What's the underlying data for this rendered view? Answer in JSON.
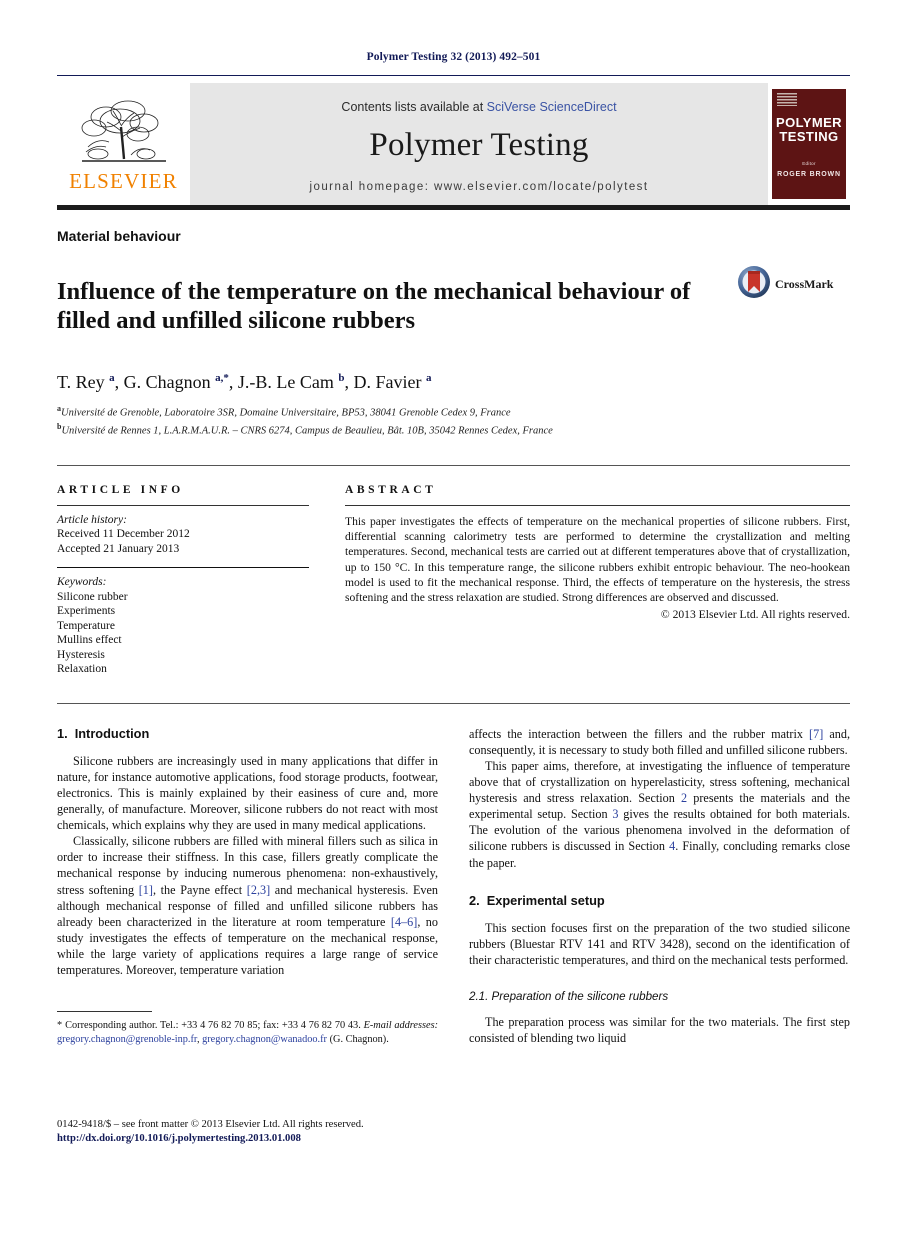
{
  "running_head": "Polymer Testing 32 (2013) 492–501",
  "masthead": {
    "publisher_word": "ELSEVIER",
    "contents_prefix": "Contents lists available at ",
    "contents_link": "SciVerse ScienceDirect",
    "journal_name": "Polymer Testing",
    "homepage": "journal homepage: www.elsevier.com/locate/polytest",
    "cover": {
      "title_line1": "POLYMER",
      "title_line2": "TESTING",
      "editor_label": "Editor",
      "editor_name": "ROGER BROWN"
    }
  },
  "article": {
    "section_label": "Material behaviour",
    "title": "Influence of the temperature on the mechanical behaviour of filled and unfilled silicone rubbers",
    "crossmark_label": "CrossMark",
    "affiliation_a": "Université de Grenoble, Laboratoire 3SR, Domaine Universitaire, BP53, 38041 Grenoble Cedex 9, France",
    "affiliation_b": "Université de Rennes 1, L.A.R.M.A.U.R. – CNRS 6274, Campus de Beaulieu, Bât. 10B, 35042 Rennes Cedex, France"
  },
  "article_info": {
    "heading": "ARTICLE INFO",
    "history_label": "Article history:",
    "received": "Received 11 December 2012",
    "accepted": "Accepted 21 January 2013",
    "keywords_label": "Keywords:",
    "keywords": [
      "Silicone rubber",
      "Experiments",
      "Temperature",
      "Mullins effect",
      "Hysteresis",
      "Relaxation"
    ]
  },
  "abstract": {
    "heading": "ABSTRACT",
    "text": "This paper investigates the effects of temperature on the mechanical properties of silicone rubbers. First, differential scanning calorimetry tests are performed to determine the crystallization and melting temperatures. Second, mechanical tests are carried out at different temperatures above that of crystallization, up to 150 °C. In this temperature range, the silicone rubbers exhibit entropic behaviour. The neo-hookean model is used to fit the mechanical response. Third, the effects of temperature on the hysteresis, the stress softening and the stress relaxation are studied. Strong differences are observed and discussed.",
    "copyright": "© 2013 Elsevier Ltd. All rights reserved."
  },
  "body": {
    "intro_heading_num": "1.",
    "intro_heading": "Introduction",
    "intro_p1": "Silicone rubbers are increasingly used in many applications that differ in nature, for instance automotive applications, food storage products, footwear, electronics. This is mainly explained by their easiness of cure and, more generally, of manufacture. Moreover, silicone rubbers do not react with most chemicals, which explains why they are used in many medical applications.",
    "intro_p2_a": "Classically, silicone rubbers are filled with mineral fillers such as silica in order to increase their stiffness. In this case, fillers greatly complicate the mechanical response by inducing numerous phenomena: non-exhaustively, stress softening ",
    "intro_p2_ref1": "[1]",
    "intro_p2_b": ", the Payne effect ",
    "intro_p2_ref2": "[2,3]",
    "intro_p2_c": " and mechanical hysteresis. Even although mechanical response of filled and unfilled silicone rubbers has already been characterized in the literature at room temperature ",
    "intro_p2_ref3": "[4–6]",
    "intro_p2_d": ", no study investigates the effects of temperature on the mechanical response, while the large variety of applications requires a large range of service temperatures. Moreover, temperature variation",
    "right_p1_a": "affects the interaction between the fillers and the rubber matrix ",
    "right_p1_ref": "[7]",
    "right_p1_b": " and, consequently, it is necessary to study both filled and unfilled silicone rubbers.",
    "right_p2_a": "This paper aims, therefore, at investigating the influence of temperature above that of crystallization on hyperelasticity, stress softening, mechanical hysteresis and stress relaxation. Section ",
    "right_p2_s2": "2",
    "right_p2_b": " presents the materials and the experimental setup. Section ",
    "right_p2_s3": "3",
    "right_p2_c": " gives the results obtained for both materials. The evolution of the various phenomena involved in the deformation of silicone rubbers is discussed in Section ",
    "right_p2_s4": "4",
    "right_p2_d": ". Finally, concluding remarks close the paper.",
    "exp_heading_num": "2.",
    "exp_heading": "Experimental setup",
    "exp_p1": "This section focuses first on the preparation of the two studied silicone rubbers (Bluestar RTV 141 and RTV 3428), second on the identification of their characteristic temperatures, and third on the mechanical tests performed.",
    "subsec_heading": "2.1. Preparation of the silicone rubbers",
    "exp_p2": "The preparation process was similar for the two materials. The first step consisted of blending two liquid"
  },
  "footnote": {
    "star": "*",
    "corresponding": "Corresponding author. Tel.: +33 4 76 82 70 85; fax: +33 4 76 82 70 43.",
    "email_label": "E-mail addresses:",
    "email1": "gregory.chagnon@grenoble-inp.fr",
    "email2": "gregory.chagnon@wanadoo.fr",
    "email_owner": " (G. Chagnon)."
  },
  "page_footer": {
    "issn_line": "0142-9418/$ – see front matter © 2013 Elsevier Ltd. All rights reserved.",
    "doi": "http://dx.doi.org/10.1016/j.polymertesting.2013.01.008"
  },
  "colors": {
    "link_navy": "#121a57",
    "ref_blue": "#2a3f9d",
    "elsevier_orange": "#f08100",
    "cover_maroon": "#5d1414",
    "band_grey": "#e6e6e6"
  }
}
